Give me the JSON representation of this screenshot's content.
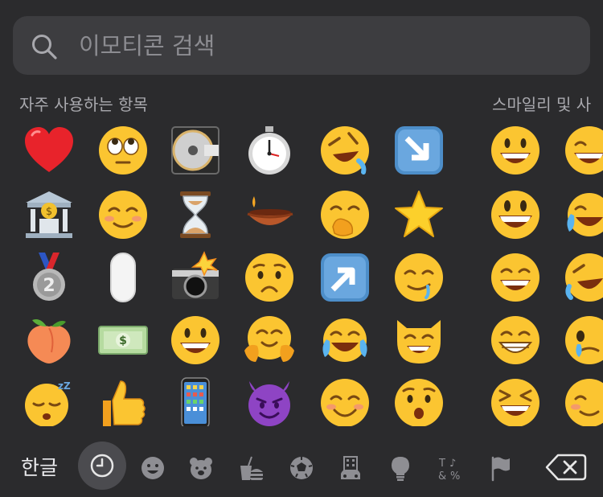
{
  "search": {
    "placeholder": "이모티콘 검색",
    "icon": "search-icon"
  },
  "sections": {
    "frequent_title": "자주 사용하는 항목",
    "smileys_title": "스마일리 및 사"
  },
  "frequent_emojis": [
    [
      "red-heart",
      "face-with-rolling-eyes",
      "minidisc",
      "stopwatch",
      "rolling-on-floor-laughing",
      "down-right-arrow"
    ],
    [
      "bank",
      "smiling-face",
      "hourglass",
      "diya-lamp",
      "face-with-hand-over-mouth",
      "star"
    ],
    [
      "second-place-medal",
      "computer-mouse",
      "camera-with-flash",
      "anxious-face",
      "up-right-arrow",
      "drooling-face"
    ],
    [
      "peach",
      "banknote",
      "grinning-face",
      "hugging-face",
      "tears-of-joy",
      "grinning-cat"
    ],
    [
      "sleeping-face",
      "thumbs-up",
      "mobile-phone",
      "smiling-devil",
      "smiling-eyes",
      "hushed-face"
    ]
  ],
  "smiley_emojis": [
    [
      "grinning-face",
      "grinning-sweat"
    ],
    [
      "grinning-big-eyes",
      "tears-of-joy"
    ],
    [
      "grinning-smiling-eyes",
      "rolling-on-floor-laughing"
    ],
    [
      "beaming-face",
      "face-holding-back-tears"
    ],
    [
      "squinting-laughing",
      "smiling-face"
    ]
  ],
  "keyboard": {
    "language_label": "한글"
  },
  "categories": [
    "recent-clock-icon",
    "smiley-icon",
    "bear-icon",
    "food-icon",
    "ball-icon",
    "building-icon",
    "lightbulb-icon",
    "symbols-icon",
    "flag-icon"
  ],
  "colors": {
    "background": "#2b2b2d",
    "search_bg": "#3d3d40",
    "face": "#fbc531",
    "heart": "#e8232b"
  }
}
